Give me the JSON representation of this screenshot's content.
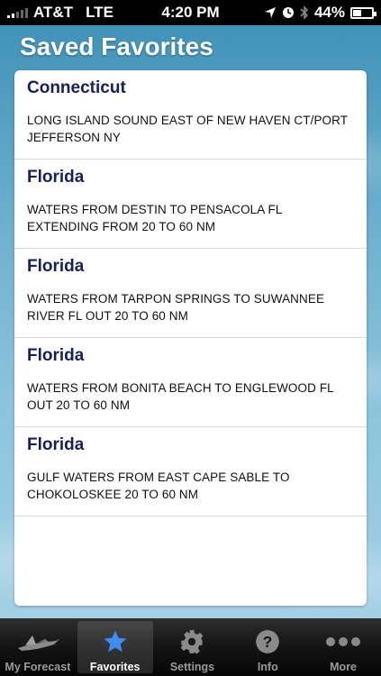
{
  "status_bar": {
    "carrier": "AT&T",
    "network": "LTE",
    "time": "4:20 PM",
    "battery": "44%",
    "battery_level": 0.44
  },
  "page": {
    "title": "Saved Favorites"
  },
  "favorites": [
    {
      "state": "Connecticut",
      "description": "LONG ISLAND SOUND EAST OF NEW HAVEN CT/PORT JEFFERSON NY"
    },
    {
      "state": "Florida",
      "description": "WATERS FROM DESTIN TO PENSACOLA FL EXTENDING FROM 20 TO 60 NM"
    },
    {
      "state": "Florida",
      "description": "WATERS FROM TARPON SPRINGS TO SUWANNEE RIVER FL OUT 20 TO 60 NM"
    },
    {
      "state": "Florida",
      "description": "WATERS FROM BONITA BEACH TO ENGLEWOOD FL OUT 20 TO 60 NM"
    },
    {
      "state": "Florida",
      "description": "GULF WATERS FROM EAST CAPE SABLE TO CHOKOLOSKEE 20 TO 60 NM"
    }
  ],
  "tabs": [
    {
      "label": "My Forecast",
      "icon": "boat-icon"
    },
    {
      "label": "Favorites",
      "icon": "star-icon",
      "active": true
    },
    {
      "label": "Settings",
      "icon": "gear-icon"
    },
    {
      "label": "Info",
      "icon": "help-icon"
    },
    {
      "label": "More",
      "icon": "more-dots-icon"
    }
  ],
  "colors": {
    "title_text": "#16205a",
    "active_icon": "#3d8df5"
  }
}
